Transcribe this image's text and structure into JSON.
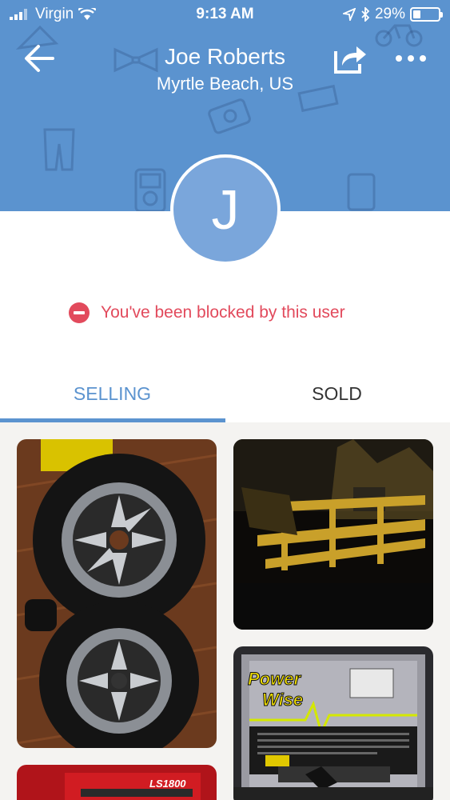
{
  "status_bar": {
    "carrier": "Virgin",
    "time": "9:13 AM",
    "battery": "29%",
    "battery_level": 0.29
  },
  "header": {
    "name": "Joe Roberts",
    "location": "Myrtle Beach, US",
    "avatar_initial": "J",
    "background_color": "#5b93cf",
    "icons": [
      "back-arrow-icon",
      "share-icon",
      "more-icon"
    ]
  },
  "blocked_message": {
    "text": "You've been blocked by this user",
    "color": "#e24a5c",
    "icon": "blocked-icon"
  },
  "tabs": [
    {
      "label": "SELLING",
      "active": true
    },
    {
      "label": "SOLD",
      "active": false
    }
  ],
  "listings": [
    {
      "name": "wheels-and-tires-photo"
    },
    {
      "name": "trailer-photo"
    },
    {
      "name": "powerwise-charger-photo",
      "visible_text": "Power Wise"
    },
    {
      "name": "red-item-photo",
      "visible_text": "LS1800"
    }
  ]
}
